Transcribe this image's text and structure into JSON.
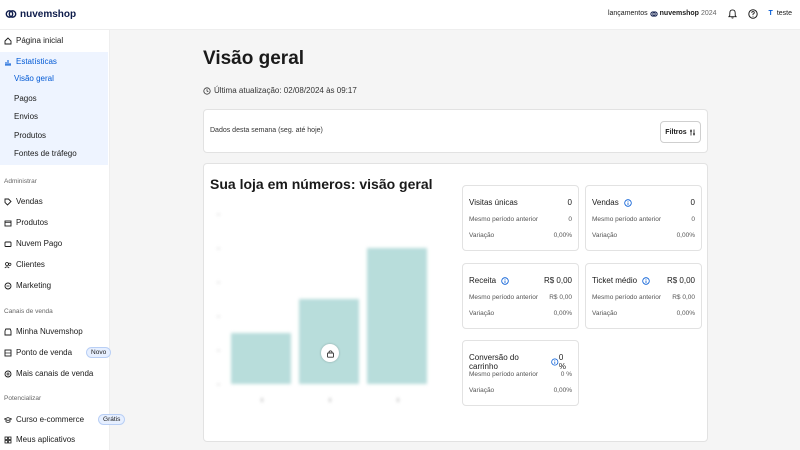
{
  "header": {
    "logo_text": "nuvemshop",
    "launches_label": "lançamentos",
    "launches_brand": "nuvemshop",
    "launches_year": "2024",
    "user_initial": "T",
    "user_name": "teste",
    "icons": [
      "bell-icon",
      "help-icon"
    ]
  },
  "sidebar": {
    "home": "Página inicial",
    "stats": "Estatísticas",
    "stats_sub": [
      "Visão geral",
      "Pagos",
      "Envios",
      "Produtos",
      "Fontes de tráfego"
    ],
    "section_admin": "Administrar",
    "admin_items": [
      "Vendas",
      "Produtos",
      "Nuvem Pago",
      "Clientes",
      "Marketing"
    ],
    "section_channels": "Canais de venda",
    "channel_items": [
      "Minha Nuvemshop",
      "Ponto de venda",
      "Mais canais de venda"
    ],
    "channel_badge": "Novo",
    "section_boost": "Potencializar",
    "boost_items": [
      "Curso e-commerce",
      "Meus aplicativos"
    ],
    "boost_badge": "Grátis"
  },
  "main": {
    "title": "Visão geral",
    "updated": "Última atualização: 02/08/2024 às 09:17",
    "filter_text": "Dados desta semana (seg. até hoje)",
    "filter_button": "Filtros",
    "section_title": "Sua loja em números: visão geral"
  },
  "metrics": [
    {
      "label": "Visitas únicas",
      "value": "0",
      "prev_label": "Mesmo período anterior",
      "prev": "0",
      "var_label": "Variação",
      "var": "0,00%"
    },
    {
      "label": "Vendas",
      "value": "0",
      "prev_label": "Mesmo período anterior",
      "prev": "0",
      "var_label": "Variação",
      "var": "0,00%"
    },
    {
      "label": "Receita",
      "value": "R$ 0,00",
      "prev_label": "Mesmo período anterior",
      "prev": "R$ 0,00",
      "var_label": "Variação",
      "var": "0,00%"
    },
    {
      "label": "Ticket médio",
      "value": "R$ 0,00",
      "prev_label": "Mesmo período anterior",
      "prev": "R$ 0,00",
      "var_label": "Variação",
      "var": "0,00%"
    },
    {
      "label": "Conversão do carrinho",
      "value": "0 %",
      "prev_label": "Mesmo período anterior",
      "prev": "0 %",
      "var_label": "Variação",
      "var": "0,00%"
    }
  ],
  "chart_data": {
    "type": "bar",
    "values": [
      3,
      5,
      8
    ],
    "ylim": [
      0,
      10
    ],
    "bar_color": "#b8dddb"
  },
  "colors": {
    "accent": "#0059d5",
    "sidebar_active_bg": "#eef4ff"
  }
}
